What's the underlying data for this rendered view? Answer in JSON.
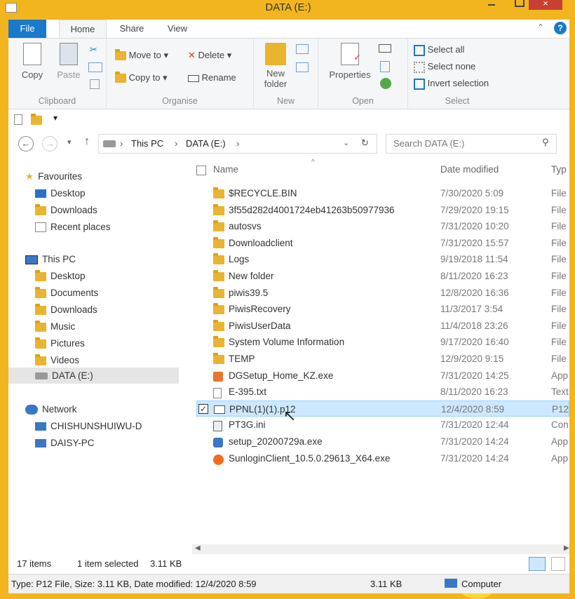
{
  "window": {
    "title": "DATA (E:)",
    "close_glyph": "×"
  },
  "ribbon_tabs": [
    "File",
    "Home",
    "Share",
    "View"
  ],
  "ribbon": {
    "clipboard": {
      "label": "Clipboard",
      "copy": "Copy",
      "paste": "Paste"
    },
    "organise": {
      "label": "Organise",
      "move_to": "Move to",
      "copy_to": "Copy to",
      "delete": "Delete",
      "rename": "Rename"
    },
    "new": {
      "label": "New",
      "new_folder_line1": "New",
      "new_folder_line2": "folder"
    },
    "open": {
      "label": "Open",
      "properties": "Properties"
    },
    "select": {
      "label": "Select",
      "select_all": "Select all",
      "select_none": "Select none",
      "invert": "Invert selection"
    }
  },
  "address": {
    "this_pc": "This PC",
    "drive": "DATA (E:)",
    "search_placeholder": "Search DATA (E:)"
  },
  "nav": {
    "favourites": "Favourites",
    "fav_items": [
      "Desktop",
      "Downloads",
      "Recent places"
    ],
    "this_pc": "This PC",
    "pc_items": [
      "Desktop",
      "Documents",
      "Downloads",
      "Music",
      "Pictures",
      "Videos",
      "DATA (E:)"
    ],
    "network": "Network",
    "net_items": [
      "CHISHUNSHUIWU-D",
      "DAISY-PC"
    ]
  },
  "columns": {
    "name": "Name",
    "date": "Date modified",
    "type": "Typ"
  },
  "files": [
    {
      "name": "$RECYCLE.BIN",
      "date": "7/30/2020 5:09",
      "type": "File",
      "icon": "folder-icon"
    },
    {
      "name": "3f55d282d4001724eb41263b50977936",
      "date": "7/29/2020 19:15",
      "type": "File",
      "icon": "folder-icon"
    },
    {
      "name": "autosvs",
      "date": "7/31/2020 10:20",
      "type": "File",
      "icon": "folder-icon"
    },
    {
      "name": "Downloadclient",
      "date": "7/31/2020 15:57",
      "type": "File",
      "icon": "folder-icon"
    },
    {
      "name": "Logs",
      "date": "9/19/2018 11:54",
      "type": "File",
      "icon": "folder-icon"
    },
    {
      "name": "New folder",
      "date": "8/11/2020 16:23",
      "type": "File",
      "icon": "folder-icon"
    },
    {
      "name": "piwis39.5",
      "date": "12/8/2020 16:36",
      "type": "File",
      "icon": "folder-icon"
    },
    {
      "name": "PiwisRecovery",
      "date": "11/3/2017 3:54",
      "type": "File",
      "icon": "folder-icon"
    },
    {
      "name": "PiwisUserData",
      "date": "11/4/2018 23:26",
      "type": "File",
      "icon": "folder-icon"
    },
    {
      "name": "System Volume Information",
      "date": "9/17/2020 16:40",
      "type": "File",
      "icon": "folder-icon"
    },
    {
      "name": "TEMP",
      "date": "12/9/2020 9:15",
      "type": "File",
      "icon": "folder-icon"
    },
    {
      "name": "DGSetup_Home_KZ.exe",
      "date": "7/31/2020 14:25",
      "type": "App",
      "icon": "exe-icon"
    },
    {
      "name": "E-395.txt",
      "date": "8/11/2020 16:23",
      "type": "Text",
      "icon": "text-file-icon"
    },
    {
      "name": "PPNL(1)(1).p12",
      "date": "12/4/2020 8:59",
      "type": "P12",
      "icon": "certificate-icon"
    },
    {
      "name": "PT3G.ini",
      "date": "7/31/2020 12:44",
      "type": "Con",
      "icon": "settings-file-icon"
    },
    {
      "name": "setup_20200729a.exe",
      "date": "7/31/2020 14:24",
      "type": "App",
      "icon": "setup-icon"
    },
    {
      "name": "SunloginClient_10.5.0.29613_X64.exe",
      "date": "7/31/2020 14:24",
      "type": "App",
      "icon": "sunlogin-icon"
    }
  ],
  "status": {
    "count": "17 items",
    "selected": "1 item selected",
    "size": "3.11 KB"
  },
  "details": {
    "info": "Type: P12 File, Size: 3.11 KB, Date modified: 12/4/2020 8:59",
    "size": "3.11 KB",
    "location": "Computer"
  },
  "colors": {
    "titlebar": "#f3b51f",
    "file_tab": "#1979ca",
    "selection": "#cce8ff"
  }
}
